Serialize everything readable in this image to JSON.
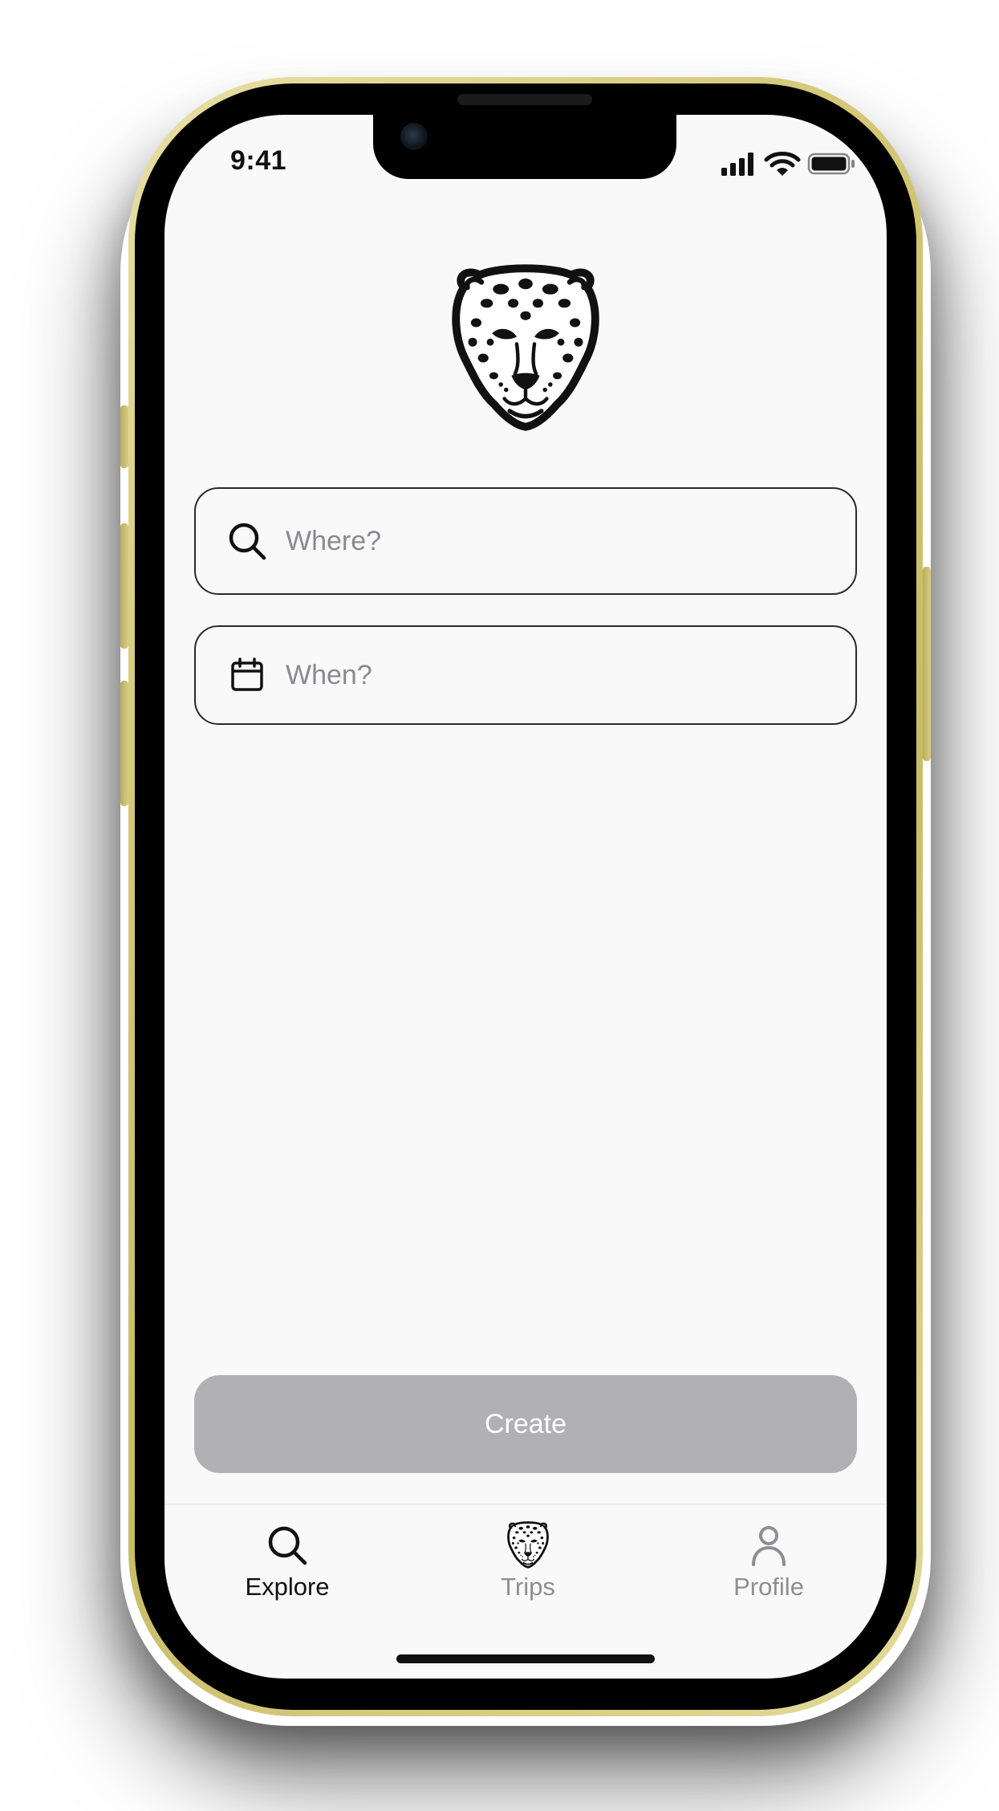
{
  "status_bar": {
    "time": "9:41",
    "icons": [
      "cellular-signal-icon",
      "wifi-icon",
      "battery-icon"
    ]
  },
  "logo": {
    "icon": "leopard-head-icon"
  },
  "search": {
    "where_placeholder": "Where?",
    "where_icon": "search-icon",
    "when_placeholder": "When?",
    "when_icon": "calendar-icon"
  },
  "actions": {
    "create_label": "Create",
    "create_enabled": false
  },
  "tab_bar": {
    "tabs": [
      {
        "label": "Explore",
        "icon": "search-icon",
        "active": true
      },
      {
        "label": "Trips",
        "icon": "leopard-head-icon",
        "active": false
      },
      {
        "label": "Profile",
        "icon": "person-icon",
        "active": false
      }
    ]
  },
  "colors": {
    "device_frame": "#d4c878",
    "screen_background": "#f9f9fa",
    "create_button_disabled": "#b1b0b3",
    "tab_active": "#111111",
    "tab_inactive": "#8e8e93",
    "placeholder_text": "#8a8a8e"
  }
}
